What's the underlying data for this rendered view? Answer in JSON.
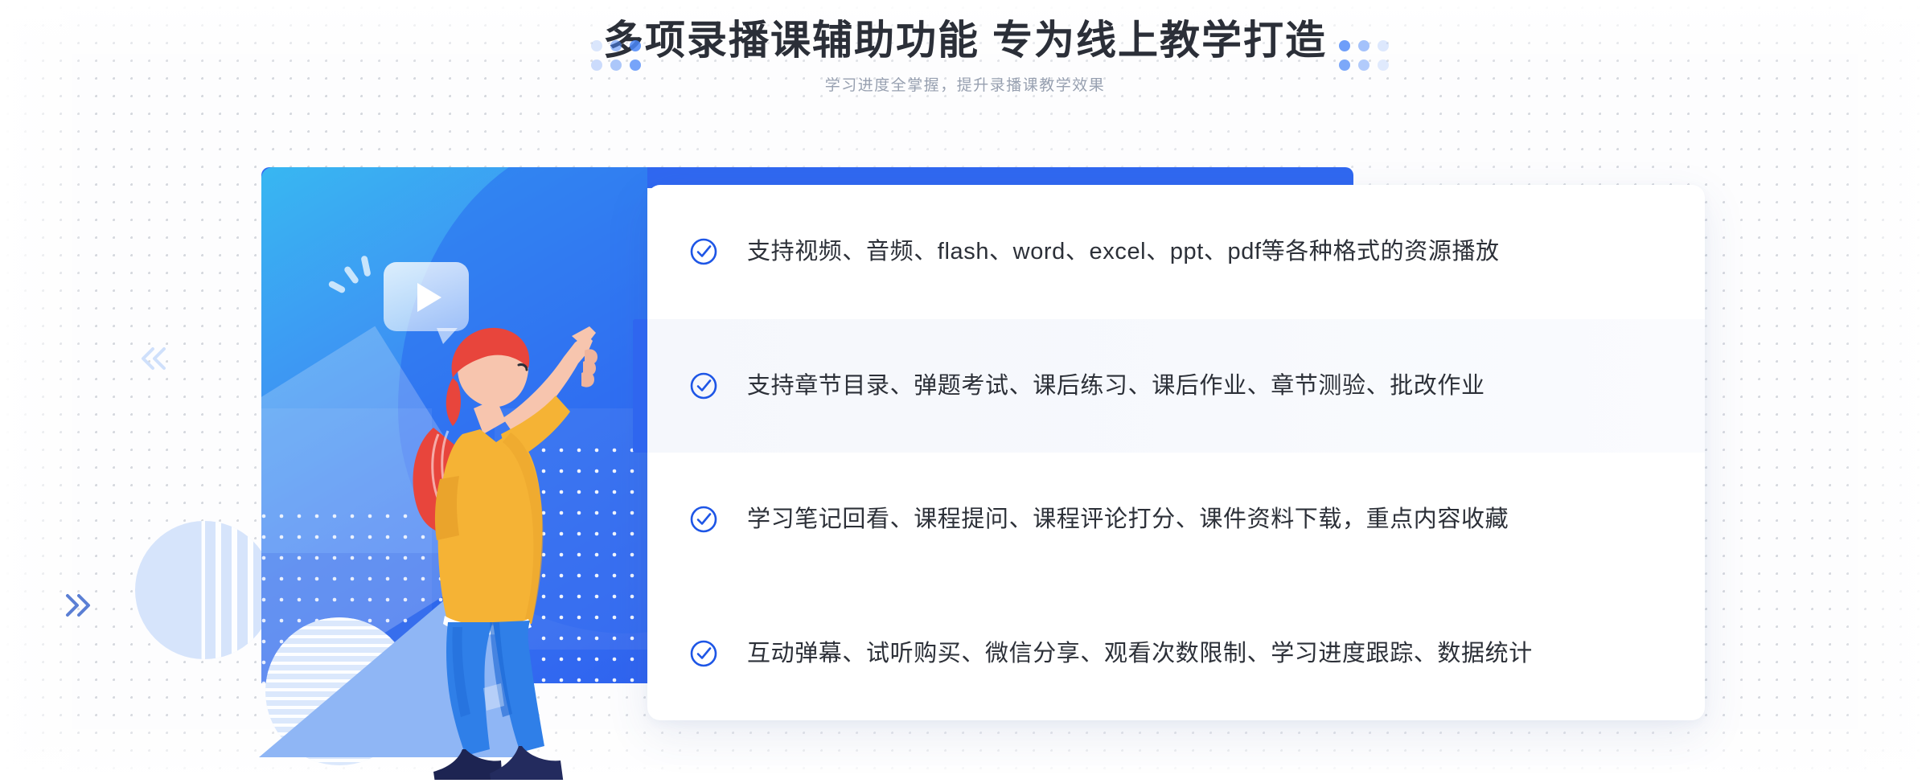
{
  "header": {
    "title": "多项录播课辅助功能 专为线上教学打造",
    "subtitle": "学习进度全掌握，提升录播课教学效果"
  },
  "features": {
    "items": [
      {
        "text": "支持视频、音频、flash、word、excel、ppt、pdf等各种格式的资源播放",
        "active": false
      },
      {
        "text": "支持章节目录、弹题考试、课后练习、课后作业、章节测验、批改作业",
        "active": true
      },
      {
        "text": "学习笔记回看、课程提问、课程评论打分、课件资料下载，重点内容收藏",
        "active": false
      },
      {
        "text": "互动弹幕、试听购买、微信分享、观看次数限制、学习进度跟踪、数据统计",
        "active": false
      }
    ],
    "check_icon": "check-circle-icon"
  },
  "illustration": {
    "play_bubble_icon": "video-play-bubble-icon",
    "chevron_left_icon": "double-chevron-left-icon",
    "chevron_right_icon": "double-chevron-right-icon",
    "character": "woman-pointing-up-illustration"
  },
  "colors": {
    "accent_blue": "#2f66ef",
    "panel_cyan": "#38b7f2",
    "panel_blue": "#2f63ef",
    "title_text": "#2b2f38",
    "subtitle_text": "#97a0b0",
    "row_text": "#2c3038",
    "active_row_bg": "#f5f7fc",
    "shirt_yellow": "#f5b335",
    "hair_red": "#e8453c",
    "skin": "#f7c5ae",
    "pants_blue": "#2f7fe8",
    "shoes_navy": "#1d2452"
  }
}
